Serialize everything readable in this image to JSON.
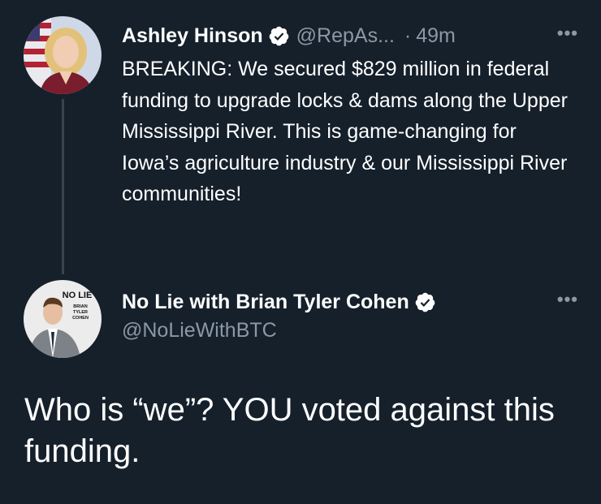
{
  "colors": {
    "background": "#15202b",
    "text_primary": "#ffffff",
    "text_secondary": "#8b98a5",
    "verified_badge": "#ffffff",
    "thread_line": "#38444d"
  },
  "quoted_tweet": {
    "author_name": "Ashley Hinson",
    "verified": true,
    "verified_icon": "verified-badge-icon",
    "handle": "@RepAs...",
    "separator": "·",
    "time": "49m",
    "more_icon": "more-dots-icon",
    "more_label": "•••",
    "text": "BREAKING: We secured $829 million in federal funding to upgrade locks & dams along the Upper Mississippi River. This is game-changing for Iowa’s agriculture industry & our Mississippi River communities!"
  },
  "reply_tweet": {
    "author_name": "No Lie with Brian Tyler Cohen",
    "verified": true,
    "verified_icon": "verified-badge-icon",
    "handle": "@NoLieWithBTC",
    "more_icon": "more-dots-icon",
    "more_label": "•••",
    "avatar_logo_text": "NO LIE",
    "avatar_logo_sub": "BRIAN TYLER COHEN",
    "text": "Who is “we”? YOU voted against this funding."
  }
}
